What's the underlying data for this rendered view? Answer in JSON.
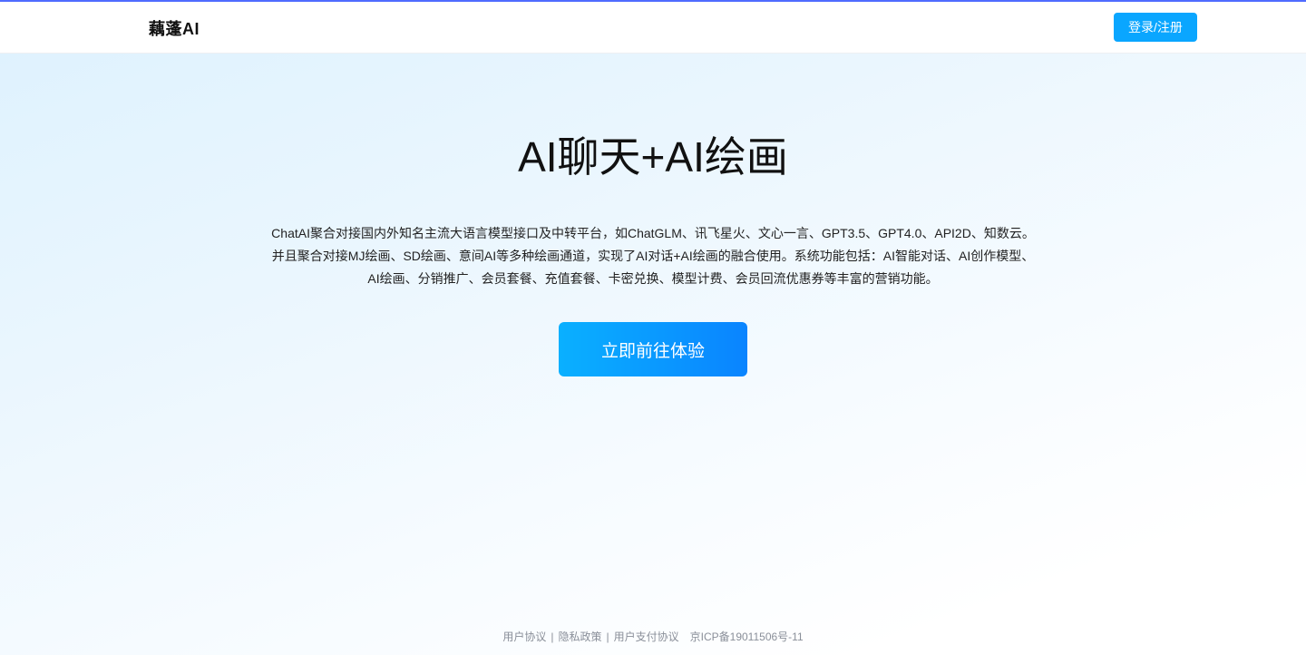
{
  "header": {
    "brand": "藕蓬AI",
    "login_label": "登录/注册"
  },
  "hero": {
    "title": "AI聊天+AI绘画",
    "description": "ChatAI聚合对接国内外知名主流大语言模型接口及中转平台，如ChatGLM、讯飞星火、文心一言、GPT3.5、GPT4.0、API2D、知数云。并且聚合对接MJ绘画、SD绘画、意间AI等多种绘画通道，实现了AI对话+AI绘画的融合使用。系统功能包括：AI智能对话、AI创作模型、AI绘画、分销推广、会员套餐、充值套餐、卡密兑换、模型计费、会员回流优惠券等丰富的营销功能。",
    "cta_label": "立即前往体验"
  },
  "footer": {
    "user_agreement": "用户协议",
    "privacy_policy": "隐私政策",
    "payment_agreement": "用户支付协议",
    "separator": "|",
    "icp": "京ICP备19011506号-11"
  },
  "colors": {
    "accent": "#0aa6ff",
    "topline": "#4f6bff"
  }
}
